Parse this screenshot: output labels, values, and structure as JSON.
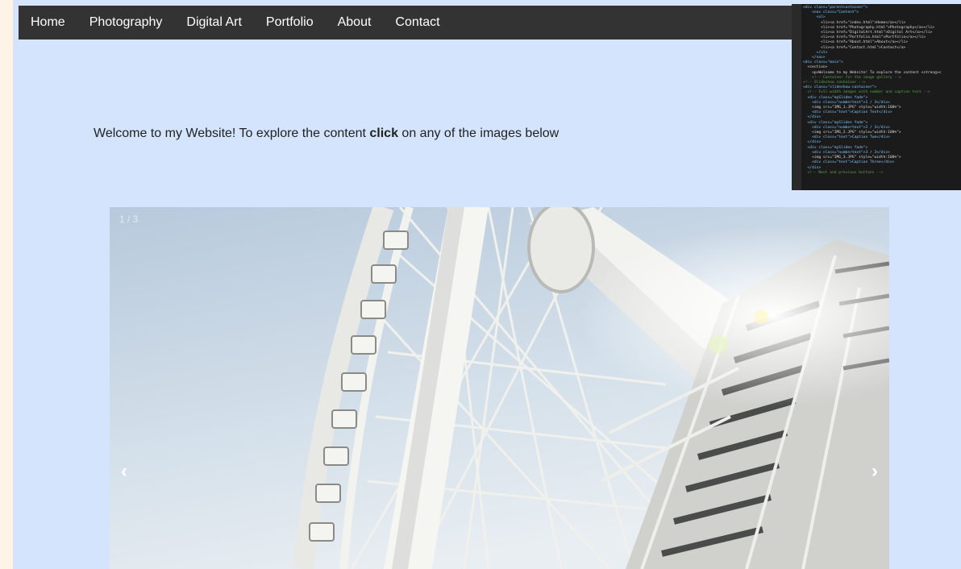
{
  "nav": {
    "items": [
      "Home",
      "Photography",
      "Digital Art",
      "Portfolio",
      "About",
      "Contact"
    ]
  },
  "intro": {
    "before": "Welcome to my Website! To explore the content ",
    "bold": "click",
    "after": " on any of the images below"
  },
  "code_thumbnail": {
    "lines": [
      "<div class=\"parentcontainer\">",
      "    <nav class=\"Content\">",
      "      <ul>",
      "        <li><a href=\"index.html\">Home</a></li>",
      "        <li><a href=\"Photography.html\">Photography</a></li>",
      "        <li><a href=\"DigitalArt.html\">Digital Art</a></li>",
      "        <li><a href=\"Portfolio.html\">Portfolio</a></li>",
      "        <li><a href=\"About.html\">About</a></li>",
      "        <li><a href=\"Contact.html\">Contact</a>",
      "      </ul>",
      "    </nav>",
      "",
      "<div class=\"main\">",
      "  <section>",
      "    <p>Welcome to my Website! To explore the content <strong>c",
      "    <!-- Container for the image gallery -->",
      "<!-- Slideshow container -->",
      "<div class=\"slideshow-container\">",
      "",
      "  <!-- Full-width images with number and caption text -->",
      "  <div class=\"mySlides fade\">",
      "    <div class=\"numbertext\">1 / 3</div>",
      "    <img src=\"IMG_1.JPG\" style=\"width:100%\">",
      "    <div class=\"text\">Caption Text</div>",
      "  </div>",
      "",
      "  <div class=\"mySlides fade\">",
      "    <div class=\"numbertext\">2 / 3</div>",
      "    <img src=\"IMG_2.JPG\" style=\"width:100%\">",
      "    <div class=\"text\">Caption Two</div>",
      "  </div>",
      "",
      "  <div class=\"mySlides fade\">",
      "    <div class=\"numbertext\">3 / 3</div>",
      "    <img src=\"IMG_3.JPG\" style=\"width:100%\">",
      "    <div class=\"text\">Caption Three</div>",
      "  </div>",
      "",
      "  <!-- Next and previous buttons -->"
    ]
  },
  "slideshow": {
    "counter": "1 / 3",
    "prev_icon": "‹",
    "next_icon": "›"
  },
  "colors": {
    "page_bg": "#d4e4fc",
    "navbar_bg": "#333333",
    "outer_bg": "#fdf3e6"
  }
}
